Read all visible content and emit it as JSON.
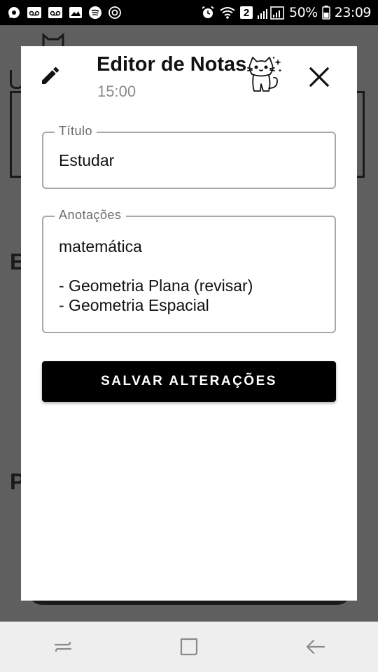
{
  "status_bar": {
    "battery_percent": "50%",
    "time": "23:09",
    "notification_badge": "2",
    "left_icons": [
      "chat-icon",
      "voicemail-icon",
      "voicemail-icon",
      "image-icon",
      "spotify-icon",
      "sync-icon"
    ],
    "right_icons": [
      "alarm-icon",
      "wifi-icon",
      "signal-icon",
      "battery-icon"
    ]
  },
  "dialog": {
    "title": "Editor de Notas",
    "time": "15:00",
    "edit_icon": "pencil-icon",
    "cat_icon": "cat-icon",
    "close_icon": "close-icon",
    "title_field": {
      "label": "Título",
      "value": "Estudar"
    },
    "notes_field": {
      "label": "Anotações",
      "value": "matemática\n\n- Geometria Plana (revisar)\n- Geometria Espacial"
    },
    "save_label": "SALVAR ALTERAÇÕES"
  },
  "background": {
    "letter_1": "E",
    "letter_2": "P"
  },
  "nav_bar": {
    "icons": [
      "recent-apps-icon",
      "home-icon",
      "back-icon"
    ]
  },
  "colors": {
    "accent": "#000000",
    "backdrop": "#5f5f5f",
    "border": "#a8a8a8",
    "muted_text": "#8a8a8a"
  }
}
